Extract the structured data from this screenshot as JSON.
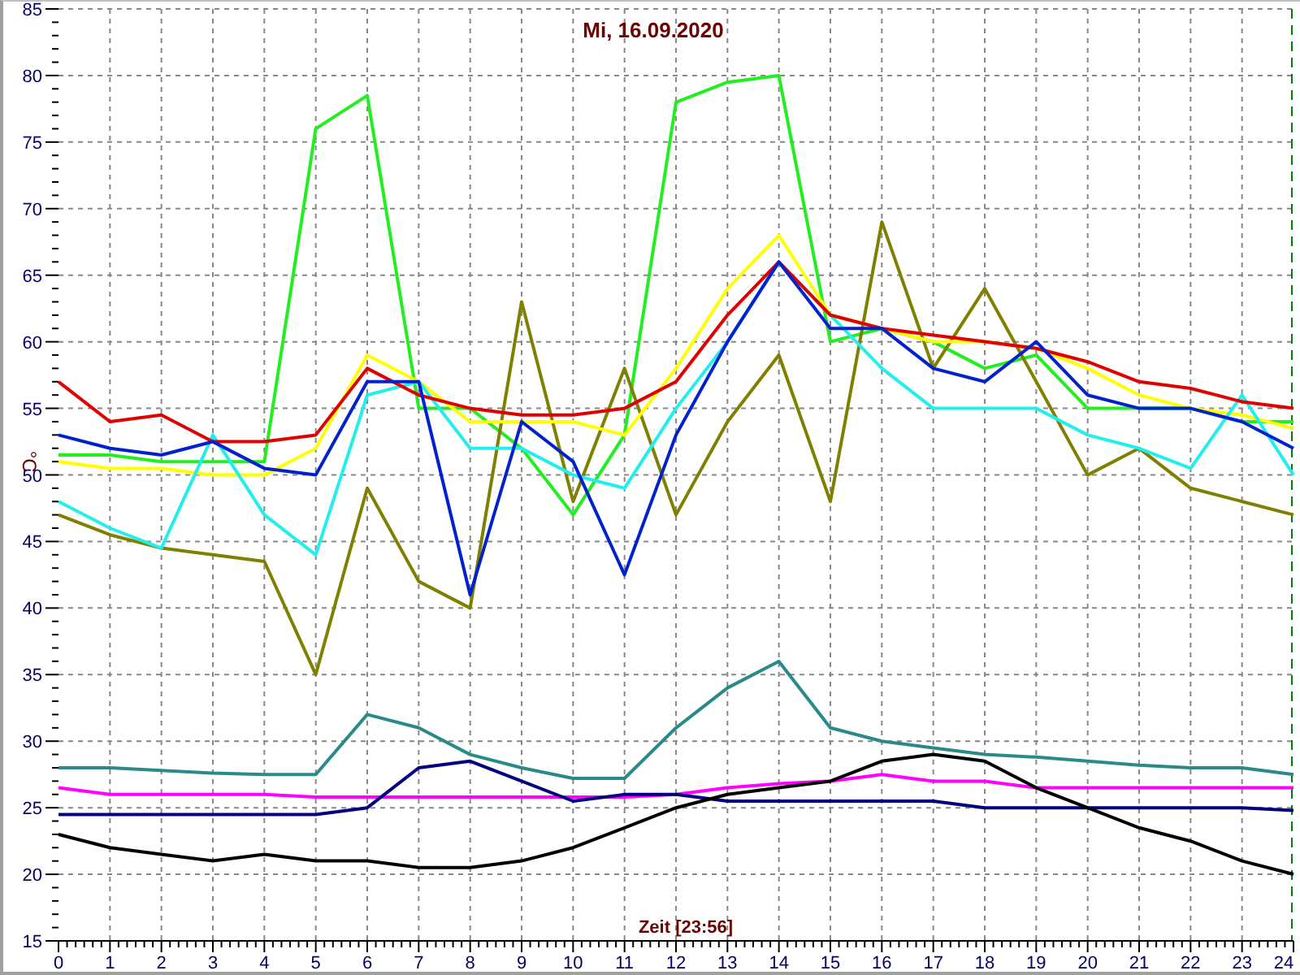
{
  "chart_data": {
    "type": "line",
    "title": "Mi, 16.09.2020",
    "xlabel": "Zeit [23:56]",
    "ylabel": "°C",
    "x": [
      0,
      1,
      2,
      3,
      4,
      5,
      6,
      7,
      8,
      9,
      10,
      11,
      12,
      13,
      14,
      15,
      16,
      17,
      18,
      19,
      20,
      21,
      22,
      23,
      24
    ],
    "grid": true,
    "xlim": [
      0,
      24
    ],
    "ylim": [
      15,
      85
    ],
    "xticks": [
      0,
      1,
      2,
      3,
      4,
      5,
      6,
      7,
      8,
      9,
      10,
      11,
      12,
      13,
      14,
      15,
      16,
      17,
      18,
      19,
      20,
      21,
      22,
      23,
      24
    ],
    "yticks": [
      15,
      20,
      25,
      30,
      35,
      40,
      45,
      50,
      55,
      60,
      65,
      70,
      75,
      80,
      85
    ],
    "series": [
      {
        "color": "#22ee22",
        "values": [
          51.5,
          51.5,
          51,
          51,
          51,
          76,
          78.5,
          55,
          55,
          52,
          47,
          53,
          78,
          79.5,
          80,
          60,
          61,
          60,
          58,
          59,
          55,
          55,
          55,
          54,
          54
        ]
      },
      {
        "color": "#808000",
        "values": [
          47,
          45.5,
          44.5,
          44,
          43.5,
          35,
          49,
          42,
          40,
          63,
          48,
          58,
          47,
          54,
          59,
          48,
          69,
          58,
          64,
          57,
          50,
          52,
          49,
          48,
          47
        ]
      },
      {
        "color": "#ffff00",
        "values": [
          51,
          50.5,
          50.5,
          50,
          50,
          52,
          59,
          57,
          54,
          54,
          54,
          53,
          58,
          64,
          68,
          62,
          61,
          60,
          60,
          59.5,
          58,
          56,
          55,
          54.5,
          53.5
        ]
      },
      {
        "color": "#22eeee",
        "values": [
          48,
          46,
          44.5,
          53,
          47,
          44,
          56,
          57,
          52,
          52,
          50,
          49,
          55,
          60,
          66,
          62,
          58,
          55,
          55,
          55,
          53,
          52,
          50.5,
          56,
          50
        ]
      },
      {
        "color": "#e00000",
        "values": [
          57,
          54,
          54.5,
          52.5,
          52.5,
          53,
          58,
          56,
          55,
          54.5,
          54.5,
          55,
          57,
          62,
          66,
          62,
          61,
          60.5,
          60,
          59.5,
          58.5,
          57,
          56.5,
          55.5,
          55
        ]
      },
      {
        "color": "#0022cc",
        "values": [
          53,
          52,
          51.5,
          52.5,
          50.5,
          50,
          57,
          57,
          41,
          54,
          51,
          42.5,
          53,
          60,
          66,
          61,
          61,
          58,
          57,
          60,
          56,
          55,
          55,
          54,
          52
        ]
      },
      {
        "color": "#2a8a8a",
        "values": [
          28,
          28,
          27.8,
          27.6,
          27.5,
          27.5,
          32,
          31,
          29,
          28,
          27.2,
          27.2,
          31,
          34,
          36,
          31,
          30,
          29.5,
          29,
          28.8,
          28.5,
          28.2,
          28,
          28,
          27.5
        ]
      },
      {
        "color": "#ff00ff",
        "values": [
          26.5,
          26,
          26,
          26,
          26,
          25.8,
          25.8,
          25.8,
          25.8,
          25.8,
          25.8,
          25.8,
          26,
          26.5,
          26.8,
          27,
          27.5,
          27,
          27,
          26.5,
          26.5,
          26.5,
          26.5,
          26.5,
          26.5
        ]
      },
      {
        "color": "#000080",
        "values": [
          24.5,
          24.5,
          24.5,
          24.5,
          24.5,
          24.5,
          25,
          28,
          28.5,
          27,
          25.5,
          26,
          26,
          25.5,
          25.5,
          25.5,
          25.5,
          25.5,
          25,
          25,
          25,
          25,
          25,
          25,
          24.8
        ]
      },
      {
        "color": "#000000",
        "values": [
          23,
          22,
          21.5,
          21,
          21.5,
          21,
          21,
          20.5,
          20.5,
          21,
          22,
          23.5,
          25,
          26,
          26.5,
          27,
          28.5,
          29,
          28.5,
          26.5,
          25,
          23.5,
          22.5,
          21,
          20
        ]
      }
    ]
  }
}
